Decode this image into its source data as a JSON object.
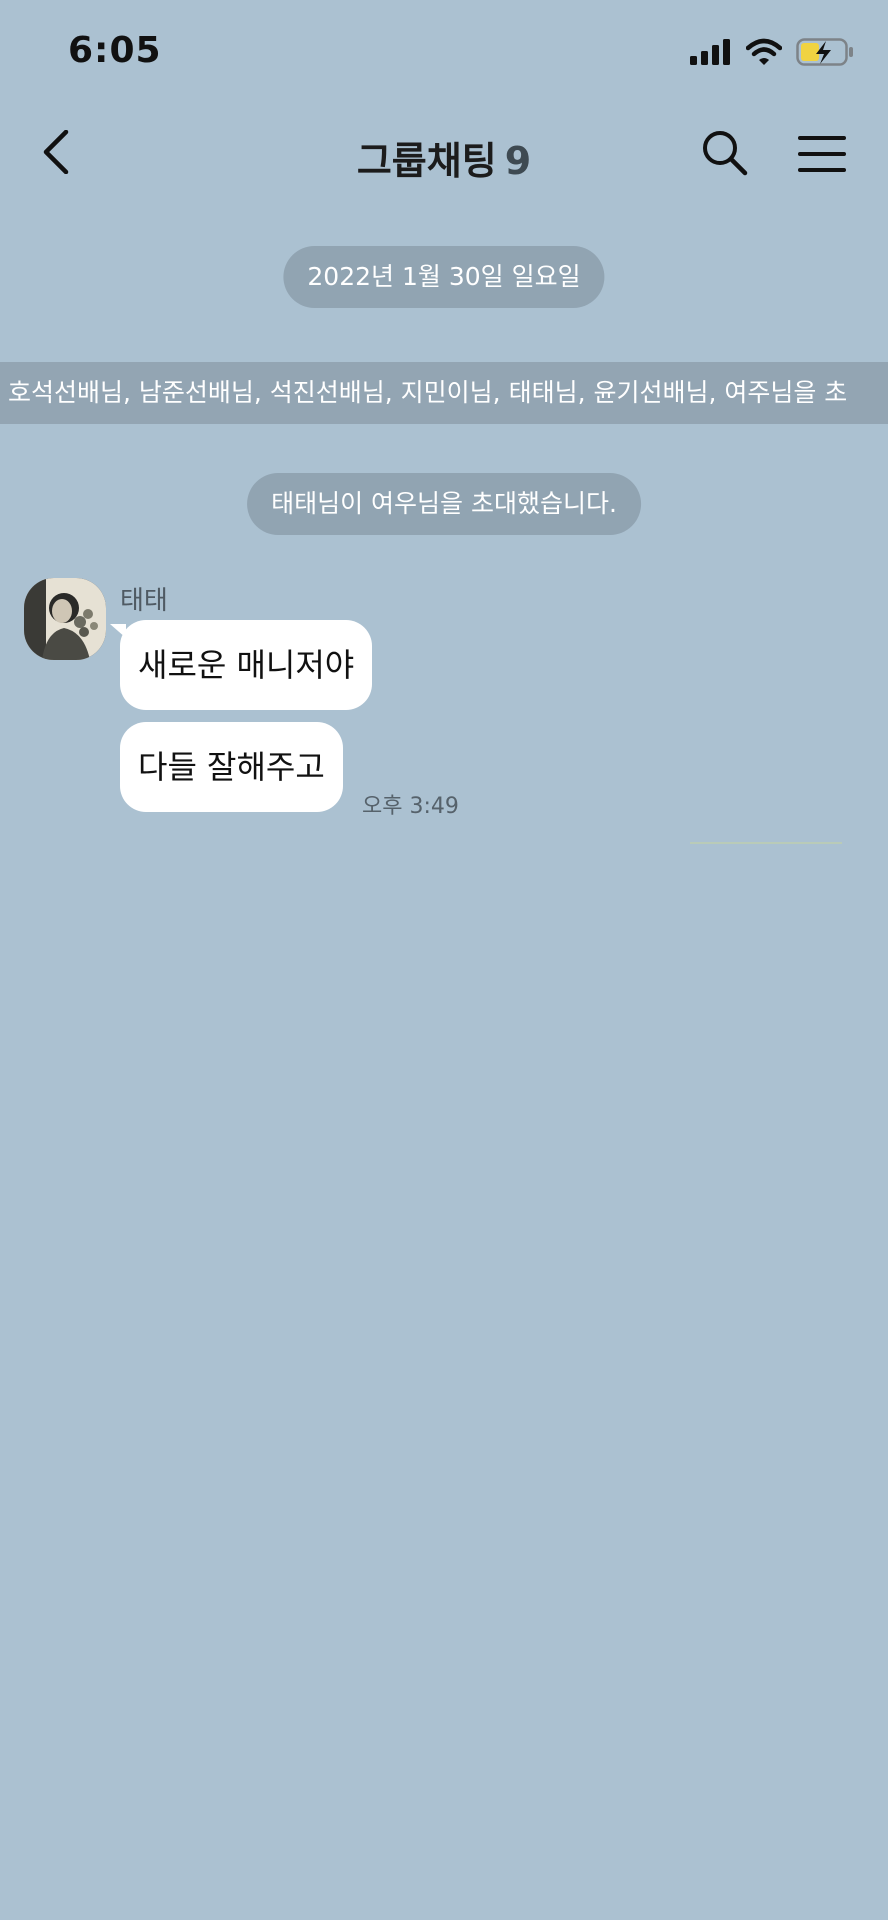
{
  "status_bar": {
    "time": "6:05"
  },
  "header": {
    "title": "그룹채팅",
    "member_count": "9"
  },
  "chat": {
    "date_divider": "2022년 1월 30일 일요일",
    "members_banner": "호석선배님, 남준선배님, 석진선배님, 지민이님, 태태님, 윤기선배님, 여주님을 초",
    "system_notice": "태태님이 여우님을 초대했습니다.",
    "messages": [
      {
        "sender": "태태",
        "lines": [
          "새로운 매니저야",
          "다들 잘해주고"
        ],
        "time": "오후 3:49"
      }
    ]
  },
  "colors": {
    "background": "#abc1d1",
    "pill": "#8799a6",
    "bubble": "#ffffff"
  },
  "icons": [
    "back-arrow-icon",
    "search-icon",
    "hamburger-menu-icon",
    "signal-icon",
    "wifi-icon",
    "battery-charging-icon"
  ]
}
